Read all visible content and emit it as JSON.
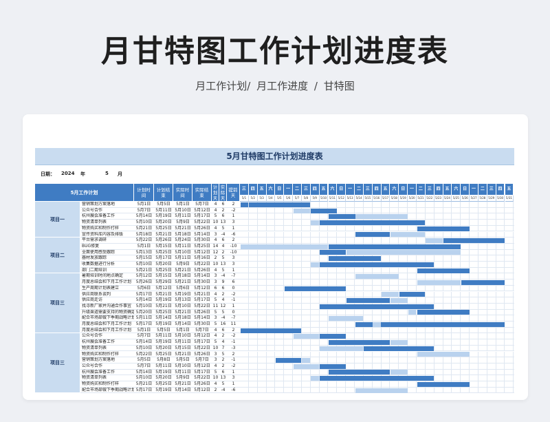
{
  "hero": {
    "title": "月甘特图工作计划进度表",
    "breadcrumb": "月工作计划/  月工作进度  /  甘特图"
  },
  "sheet": {
    "title": "5月甘特图工作计划进度表",
    "date_label": "日期：",
    "year": "2024",
    "year_unit": "年",
    "month": "5",
    "month_unit": "月",
    "headers": {
      "task": "5月工作计划",
      "plan_start": "计划时间",
      "plan_end": "计划结束",
      "actual_start": "实际时间",
      "actual_end": "实际结束",
      "plan_days": "计划天",
      "actual_days": "实际天",
      "ahead": "提前天"
    },
    "weekdays": [
      "三",
      "四",
      "五",
      "六",
      "日",
      "一",
      "二",
      "三",
      "四",
      "五",
      "六",
      "日",
      "一",
      "二",
      "三",
      "四",
      "五",
      "六",
      "日",
      "一",
      "二",
      "三",
      "四",
      "五",
      "六",
      "日",
      "一",
      "二",
      "三",
      "四",
      "五"
    ],
    "dates": [
      "5/1",
      "5/2",
      "5/3",
      "5/4",
      "5/5",
      "5/6",
      "5/7",
      "5/8",
      "5/9",
      "5/10",
      "5/11",
      "5/12",
      "5/13",
      "5/14",
      "5/15",
      "5/16",
      "5/17",
      "5/18",
      "5/19",
      "5/20",
      "5/21",
      "5/22",
      "5/23",
      "5/24",
      "5/25",
      "5/26",
      "5/27",
      "5/28",
      "5/29",
      "5/30",
      "5/31"
    ],
    "groups": [
      {
        "name": "项目一",
        "rows": 6
      },
      {
        "name": "项目二",
        "rows": 6
      },
      {
        "name": "项目三",
        "rows": 10
      },
      {
        "name": "项目三",
        "rows": 10
      }
    ],
    "rows": [
      {
        "task": "营销策划方案落地",
        "ps": "5月1日",
        "pe": "5月5日",
        "as": "5月1日",
        "ae": "5月7日",
        "pd": "4",
        "ad": "6",
        "ah": "2"
      },
      {
        "task": "公众号合作",
        "ps": "5月7日",
        "pe": "5月11日",
        "as": "5月10日",
        "ae": "5月12日",
        "pd": "4",
        "ad": "2",
        "ah": "-2"
      },
      {
        "task": "杭州展会准备工作",
        "ps": "5月14日",
        "pe": "5月19日",
        "as": "5月11日",
        "ae": "5月17日",
        "pd": "5",
        "ad": "6",
        "ah": "1"
      },
      {
        "task": "物资清单列表",
        "ps": "5月10日",
        "pe": "5月20日",
        "as": "5月9日",
        "ae": "5月22日",
        "pd": "10",
        "ad": "13",
        "ah": "3"
      },
      {
        "task": "物资购买和制作打样",
        "ps": "5月21日",
        "pe": "5月25日",
        "as": "5月21日",
        "ae": "5月26日",
        "pd": "4",
        "ad": "5",
        "ah": "1"
      },
      {
        "task": "宣传资料库内容及排版",
        "ps": "5月18日",
        "pe": "5月21日",
        "as": "5月18日",
        "ae": "5月14日",
        "pd": "3",
        "ad": "-4",
        "ah": "-6"
      },
      {
        "task": "平台需求调研",
        "ps": "5月22日",
        "pe": "5月26日",
        "as": "5月24日",
        "ae": "5月30日",
        "pd": "4",
        "ad": "6",
        "ah": "2"
      },
      {
        "task": "BUG修复",
        "ps": "5月1日",
        "pe": "5月15日",
        "as": "5月11日",
        "ae": "5月25日",
        "pd": "14",
        "ad": "4",
        "ah": "-10"
      },
      {
        "task": "全面使用感受跟踪",
        "ps": "5月13日",
        "pe": "5月25日",
        "as": "5月10日",
        "ae": "5月12日",
        "pd": "12",
        "ad": "2",
        "ah": "-10"
      },
      {
        "task": "器材发放跟踪",
        "ps": "5月15日",
        "pe": "5月17日",
        "as": "5月11日",
        "ae": "5月16日",
        "pd": "2",
        "ad": "5",
        "ah": "3"
      },
      {
        "task": "收集数据进行分析",
        "ps": "5月10日",
        "pe": "5月20日",
        "as": "5月9日",
        "ae": "5月22日",
        "pd": "10",
        "ad": "13",
        "ah": "3"
      },
      {
        "task": "部门二期培训",
        "ps": "5月21日",
        "pe": "5月25日",
        "as": "5月21日",
        "ae": "5月26日",
        "pd": "4",
        "ad": "5",
        "ah": "1"
      },
      {
        "task": "暑期培训时间地点确定",
        "ps": "5月12日",
        "pe": "5月15日",
        "as": "5月18日",
        "ae": "5月14日",
        "pd": "3",
        "ad": "-4",
        "ah": "-7"
      },
      {
        "task": "月度总结会和下月工作计划",
        "ps": "5月26日",
        "pe": "5月29日",
        "as": "5月21日",
        "ae": "5月30日",
        "pd": "3",
        "ad": "9",
        "ah": "6"
      },
      {
        "task": "生产周期计划表建立",
        "ps": "5月6日",
        "pe": "5月12日",
        "as": "5月6日",
        "ae": "5月12日",
        "pd": "6",
        "ad": "6",
        "ah": "0"
      },
      {
        "task": "供应商联系谈判",
        "ps": "5月17日",
        "pe": "5月21日",
        "as": "5月19日",
        "ae": "5月21日",
        "pd": "4",
        "ad": "2",
        "ah": "-2"
      },
      {
        "task": "供应商走访",
        "ps": "5月14日",
        "pe": "5月19日",
        "as": "5月13日",
        "ae": "5月17日",
        "pd": "5",
        "ad": "4",
        "ah": "-1"
      },
      {
        "task": "找寻新厂家并沟通合作事宜",
        "ps": "5月10日",
        "pe": "5月21日",
        "as": "5月10日",
        "ae": "5月22日",
        "pd": "11",
        "ad": "12",
        "ah": "1"
      },
      {
        "task": "升级渠道需要支持的物资确定",
        "ps": "5月20日",
        "pe": "5月25日",
        "as": "5月21日",
        "ae": "5月26日",
        "pd": "5",
        "ad": "5",
        "ah": "0"
      },
      {
        "task": "配合市场部做下季期战略计划",
        "ps": "5月11日",
        "pe": "5月14日",
        "as": "5月18日",
        "ae": "5月14日",
        "pd": "3",
        "ad": "-4",
        "ah": "-7"
      },
      {
        "task": "月度总结会和下月工作计划",
        "ps": "5月17日",
        "pe": "5月19日",
        "as": "5月14日",
        "ae": "5月30日",
        "pd": "5",
        "ad": "16",
        "ah": "11"
      },
      {
        "task": "月度总结会和下月工作计划",
        "ps": "5月1日",
        "pe": "5月5日",
        "as": "5月1日",
        "ae": "5月7日",
        "pd": "4",
        "ad": "6",
        "ah": "2"
      },
      {
        "task": "公众号合作",
        "ps": "5月7日",
        "pe": "5月11日",
        "as": "5月10日",
        "ae": "5月12日",
        "pd": "4",
        "ad": "2",
        "ah": "-2"
      },
      {
        "task": "杭州展会准备工作",
        "ps": "5月14日",
        "pe": "5月19日",
        "as": "5月11日",
        "ae": "5月17日",
        "pd": "5",
        "ad": "4",
        "ah": "-1"
      },
      {
        "task": "物资清单列表",
        "ps": "5月10日",
        "pe": "5月20日",
        "as": "5月15日",
        "ae": "5月22日",
        "pd": "10",
        "ad": "7",
        "ah": "-3"
      },
      {
        "task": "物资购买和制作打样",
        "ps": "5月22日",
        "pe": "5月25日",
        "as": "5月21日",
        "ae": "5月26日",
        "pd": "3",
        "ad": "5",
        "ah": "2"
      },
      {
        "task": "营销策划方案落地",
        "ps": "5月5日",
        "pe": "5月8日",
        "as": "5月5日",
        "ae": "5月7日",
        "pd": "3",
        "ad": "2",
        "ah": "-1"
      },
      {
        "task": "公众号合作",
        "ps": "5月7日",
        "pe": "5月11日",
        "as": "5月10日",
        "ae": "5月12日",
        "pd": "4",
        "ad": "2",
        "ah": "-2"
      },
      {
        "task": "杭州展会准备工作",
        "ps": "5月14日",
        "pe": "5月19日",
        "as": "5月11日",
        "ae": "5月17日",
        "pd": "5",
        "ad": "6",
        "ah": "1"
      },
      {
        "task": "物资清单列表",
        "ps": "5月10日",
        "pe": "5月20日",
        "as": "5月9日",
        "ae": "5月22日",
        "pd": "10",
        "ad": "13",
        "ah": "3"
      },
      {
        "task": "物资购买和制作打样",
        "ps": "5月21日",
        "pe": "5月25日",
        "as": "5月21日",
        "ae": "5月26日",
        "pd": "4",
        "ad": "5",
        "ah": "1"
      },
      {
        "task": "配合市场部做下季期战略计划",
        "ps": "5月17日",
        "pe": "5月19日",
        "as": "5月14日",
        "ae": "5月12日",
        "pd": "2",
        "ad": "-4",
        "ah": "-6"
      }
    ],
    "bars": [
      [
        [
          1,
          1,
          "d"
        ],
        [
          2,
          8,
          "d"
        ]
      ],
      [
        [
          7,
          8,
          "l"
        ],
        [
          9,
          11,
          "d"
        ]
      ],
      [
        [
          11,
          17,
          "d"
        ],
        [
          14,
          19,
          "l"
        ]
      ],
      [
        [
          9,
          9,
          "l"
        ],
        [
          10,
          21,
          "d"
        ]
      ],
      [
        [
          21,
          26,
          "d"
        ]
      ],
      [
        [
          18,
          21,
          "l"
        ],
        [
          14,
          17,
          "d"
        ]
      ],
      [
        [
          22,
          23,
          "l"
        ],
        [
          24,
          30,
          "d"
        ]
      ],
      [
        [
          1,
          10,
          "l"
        ],
        [
          11,
          25,
          "d"
        ]
      ],
      [
        [
          10,
          12,
          "d"
        ],
        [
          13,
          25,
          "l"
        ]
      ],
      [
        [
          11,
          16,
          "d"
        ]
      ],
      [
        [
          9,
          9,
          "l"
        ],
        [
          10,
          22,
          "d"
        ]
      ],
      [
        [
          21,
          26,
          "d"
        ]
      ],
      [
        [
          14,
          18,
          "l"
        ]
      ],
      [
        [
          21,
          25,
          "l"
        ],
        [
          26,
          30,
          "d"
        ]
      ],
      [
        [
          6,
          12,
          "d"
        ]
      ],
      [
        [
          17,
          18,
          "l"
        ],
        [
          19,
          21,
          "d"
        ]
      ],
      [
        [
          13,
          17,
          "d"
        ],
        [
          18,
          19,
          "l"
        ]
      ],
      [
        [
          10,
          22,
          "d"
        ]
      ],
      [
        [
          20,
          20,
          "l"
        ],
        [
          21,
          26,
          "d"
        ]
      ],
      [
        [
          11,
          14,
          "l"
        ]
      ],
      [
        [
          14,
          30,
          "d"
        ],
        [
          16,
          16,
          "l"
        ]
      ],
      [
        [
          1,
          7,
          "l"
        ],
        [
          1,
          7,
          "d"
        ]
      ],
      [
        [
          7,
          9,
          "l"
        ],
        [
          10,
          12,
          "d"
        ]
      ],
      [
        [
          11,
          17,
          "d"
        ],
        [
          18,
          19,
          "l"
        ]
      ],
      [
        [
          10,
          14,
          "l"
        ],
        [
          15,
          22,
          "d"
        ]
      ],
      [
        [
          21,
          26,
          "l"
        ]
      ],
      [
        [
          5,
          7,
          "d"
        ],
        [
          8,
          8,
          "l"
        ]
      ],
      [
        [
          7,
          9,
          "l"
        ],
        [
          10,
          12,
          "d"
        ]
      ],
      [
        [
          11,
          17,
          "d"
        ],
        [
          18,
          19,
          "l"
        ]
      ],
      [
        [
          9,
          9,
          "l"
        ],
        [
          10,
          22,
          "d"
        ]
      ],
      [
        [
          21,
          26,
          "d"
        ]
      ],
      [
        [
          14,
          19,
          "l"
        ]
      ]
    ]
  }
}
